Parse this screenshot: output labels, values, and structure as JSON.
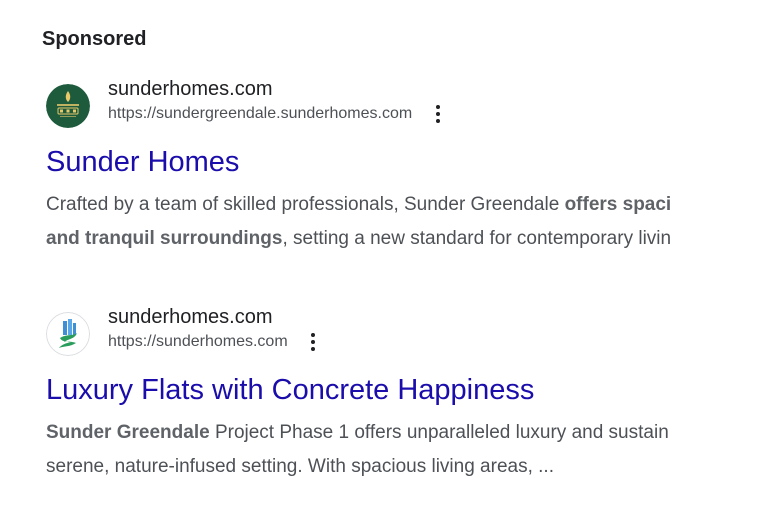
{
  "section_label": "Sponsored",
  "ads": [
    {
      "site_name": "sunderhomes.com",
      "display_url": "https://sundergreendale.sunderhomes.com",
      "favicon": "sunder-greendale-logo-icon",
      "title": "Sunder Homes",
      "desc_line1_pre": "Crafted by a team of skilled professionals, Sunder Greendale ",
      "desc_line1_bold": "offers spaci",
      "desc_line2_bold": "and tranquil surroundings",
      "desc_line2_post": ", setting a new standard for contemporary livin"
    },
    {
      "site_name": "sunderhomes.com",
      "display_url": "https://sunderhomes.com",
      "favicon": "sunder-homes-building-logo-icon",
      "title": "Luxury Flats with Concrete Happiness",
      "desc_line1_bold": "Sunder Greendale",
      "desc_line1_post": " Project Phase 1 offers unparalleled luxury and sustain",
      "desc_line2": "serene, nature-infused setting. With spacious living areas, ..."
    }
  ],
  "colors": {
    "title_link": "#1a0dab",
    "body_text": "#4d5156",
    "favicon1_bg": "#1e5a3c",
    "favicon1_accent": "#e8c86a"
  }
}
